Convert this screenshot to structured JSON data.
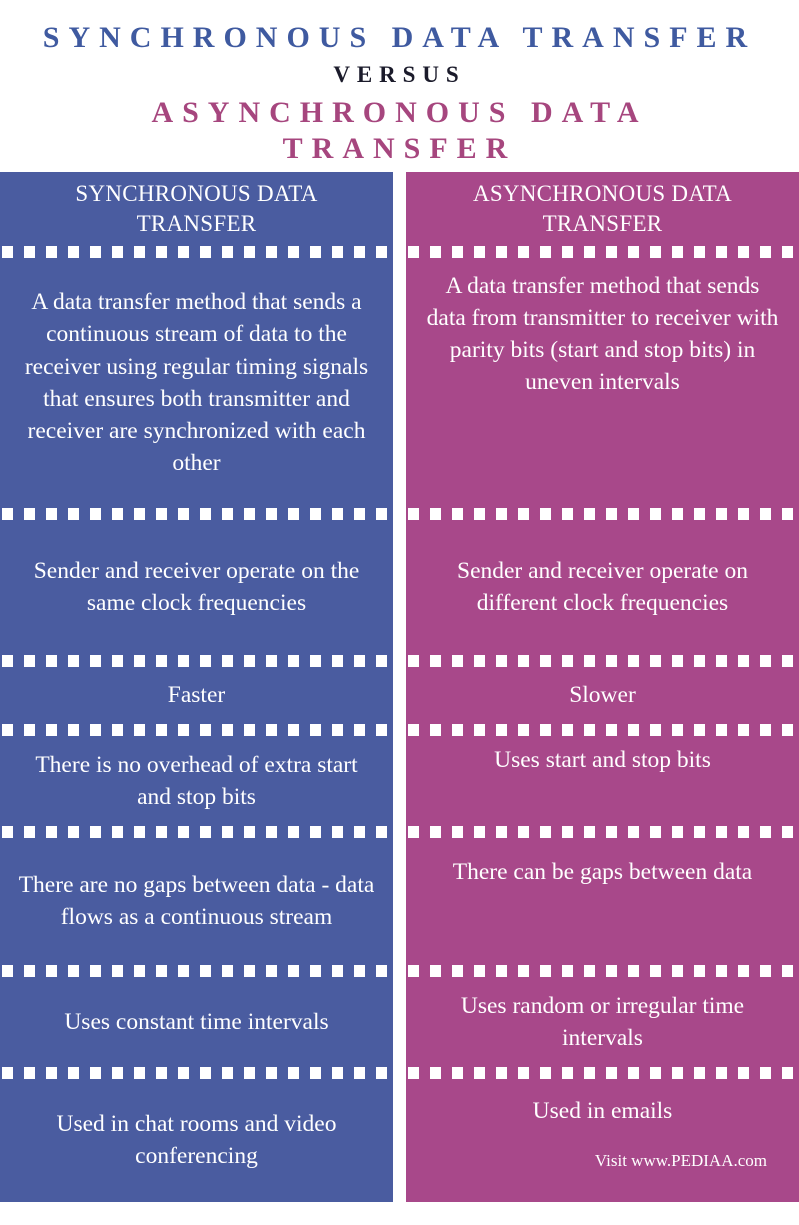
{
  "title": {
    "main": "SYNCHRONOUS DATA TRANSFER",
    "versus": "VERSUS",
    "alternate": "ASYNCHRONOUS DATA TRANSFER"
  },
  "colors": {
    "title_main": "#3F5AA0",
    "title_alternate": "#A6467E",
    "title_versus": "#1B1B2B",
    "column_left_bg": "#4A5CA0",
    "column_right_bg": "#A8488A",
    "text": "#FFFFFF",
    "page_bg": "#FFFFFF"
  },
  "table": {
    "headers": [
      "SYNCHRONOUS DATA TRANSFER",
      "ASYNCHRONOUS DATA TRANSFER"
    ],
    "rows": [
      {
        "left": "A data transfer method that sends a continuous stream of data to the receiver using regular timing signals that ensures both transmitter and receiver are synchronized with each other",
        "right": "A data transfer method that sends data from transmitter to receiver with parity bits (start and stop bits) in uneven intervals"
      },
      {
        "left": "Sender and receiver operate on the same clock frequencies",
        "right": "Sender and receiver operate on different clock frequencies"
      },
      {
        "left": "Faster",
        "right": "Slower"
      },
      {
        "left": "There is no overhead of extra start and stop bits",
        "right": "Uses start and stop bits"
      },
      {
        "left": "There are no gaps between data - data flows as a continuous stream",
        "right": "There can be gaps between data"
      },
      {
        "left": "Uses constant time intervals",
        "right": "Uses random or irregular time intervals"
      },
      {
        "left": "Used in chat rooms and video conferencing",
        "right": "Used in emails"
      }
    ]
  },
  "footer": {
    "credit": "Visit www.PEDIAA.com"
  }
}
